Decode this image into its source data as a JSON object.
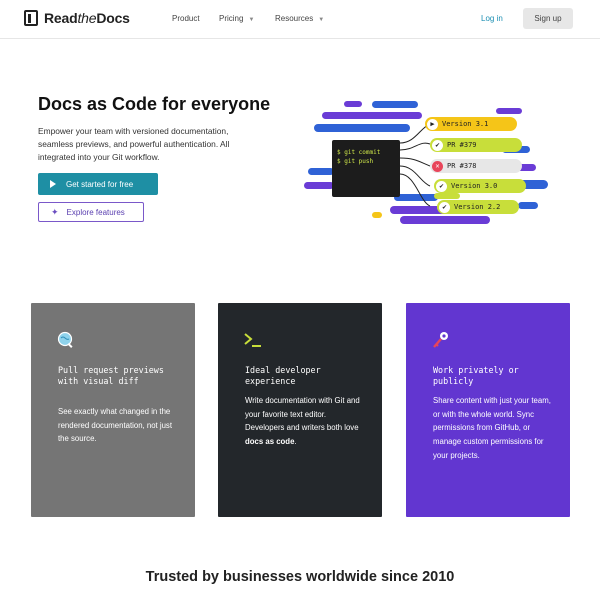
{
  "nav": {
    "logo_read": "Read",
    "logo_the": "the",
    "logo_docs": "Docs",
    "items": [
      {
        "label": "Product"
      },
      {
        "label": "Pricing"
      },
      {
        "label": "Resources"
      }
    ],
    "login": "Log in",
    "signup": "Sign up"
  },
  "hero": {
    "title": "Docs as Code for everyone",
    "subtitle": "Empower your team with versioned documentation, seamless previews, and powerful authentication. All integrated into your Git workflow.",
    "cta": "Get started for free",
    "explore": "Explore features"
  },
  "illustration": {
    "terminal": [
      "$ git commit",
      "$ git push"
    ],
    "pills": [
      {
        "label": "Version 3.1",
        "status": "play",
        "color": "#f5c518"
      },
      {
        "label": "PR #379",
        "status": "check",
        "color": "#c8de3a"
      },
      {
        "label": "PR #378",
        "status": "fail",
        "color": "#e7e7e7"
      },
      {
        "label": "Version 3.0",
        "status": "check",
        "color": "#c8de3a"
      },
      {
        "label": "Version 2.2",
        "status": "check",
        "color": "#c8de3a"
      }
    ],
    "colors": {
      "purple": "#6a3cd6",
      "blue": "#2f62d6",
      "yellow": "#f5c518",
      "green": "#c8de3a",
      "red": "#e8455a"
    }
  },
  "cards": [
    {
      "icon": "magnifier-globe-icon",
      "title": "Pull request previews with visual diff",
      "body_text": "See exactly what changed in the rendered documentation, not just the source.",
      "bg": "#757575"
    },
    {
      "icon": "terminal-prompt-icon",
      "title": "Ideal developer experience",
      "body_pre": "Write documentation with Git and your favorite text editor. Developers and writers both love ",
      "body_bold": "docs as code",
      "body_post": ".",
      "bg": "#23272b"
    },
    {
      "icon": "key-icon",
      "title": "Work privately or publicly",
      "body_text": "Share content with just your team, or with the whole world. Sync permissions from GitHub, or manage custom permissions for your projects.",
      "bg": "#6236d0"
    }
  ],
  "trusted": "Trusted by businesses worldwide since 2010"
}
